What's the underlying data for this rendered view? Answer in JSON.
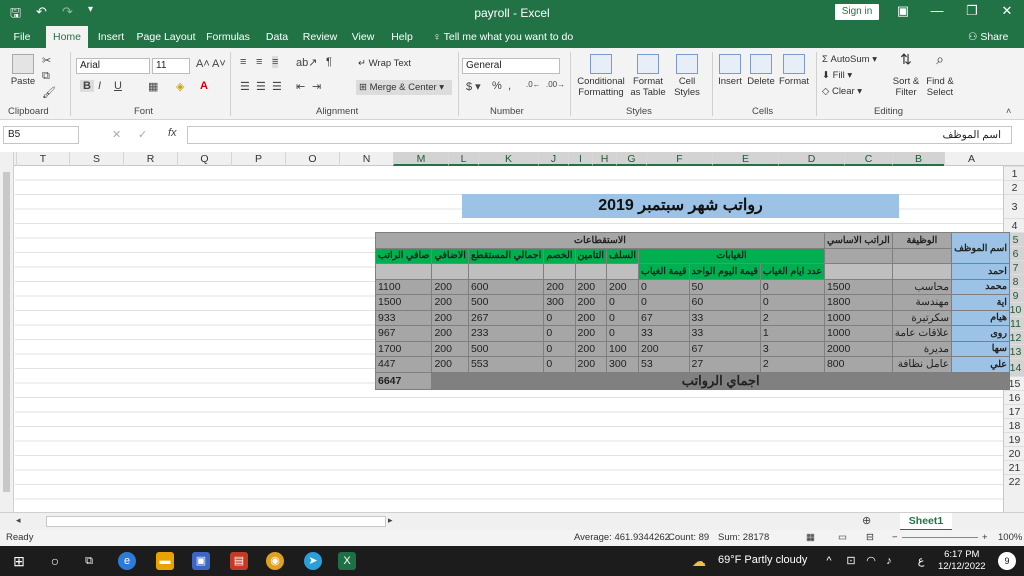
{
  "window": {
    "title": "payroll - Excel",
    "sign_in": "Sign in"
  },
  "tabs": [
    "File",
    "Home",
    "Insert",
    "Page Layout",
    "Formulas",
    "Data",
    "Review",
    "View",
    "Help"
  ],
  "tell_me": "Tell me what you want to do",
  "share": "Share",
  "ribbon": {
    "paste": "Paste",
    "font_name": "Arial",
    "font_size": "11",
    "wrap_text": "Wrap Text",
    "merge_center": "Merge & Center",
    "number_format": "General",
    "conditional_formatting": "Conditional Formatting",
    "format_as_table": "Format as Table",
    "cell_styles": "Cell Styles",
    "insert": "Insert",
    "delete": "Delete",
    "format": "Format",
    "autosum": "AutoSum",
    "fill": "Fill",
    "clear": "Clear",
    "sort_filter": "Sort & Filter",
    "find_select": "Find & Select",
    "groups": {
      "clipboard": "Clipboard",
      "font": "Font",
      "alignment": "Alignment",
      "number": "Number",
      "styles": "Styles",
      "cells": "Cells",
      "editing": "Editing"
    }
  },
  "formula_bar": {
    "name_box": "B5",
    "fx": "fx",
    "content": "اسم الموظف"
  },
  "columns": [
    "T",
    "S",
    "R",
    "Q",
    "P",
    "O",
    "N",
    "M",
    "L",
    "K",
    "J",
    "I",
    "H",
    "G",
    "F",
    "E",
    "D",
    "C",
    "B",
    "A"
  ],
  "rows": [
    "1",
    "2",
    "3",
    "4",
    "5",
    "6",
    "7",
    "8",
    "9",
    "10",
    "11",
    "12",
    "13",
    "14",
    "15",
    "16",
    "17",
    "18",
    "19",
    "20",
    "21",
    "22"
  ],
  "sheet_title": "رواتب شهر سبتمبر 2019",
  "table": {
    "h_employee": "اسم الموظف",
    "h_job": "الوظيفة",
    "h_base": "الراتب الاساسي",
    "h_deductions": "الاستقطاعات",
    "h_absences": "الغيابات",
    "h_absence_days": "عدد ايام الغياب",
    "h_day_value": "قيمة اليوم الواحد",
    "h_absence_value": "قيمة الغياب",
    "h_advances": "السلف",
    "h_insurance": "التامين",
    "h_discount": "الخصم",
    "h_total_ded": "اجمالي المستقطع",
    "h_overtime": "الاضافي",
    "h_net": "صافي الراتب",
    "rows": [
      {
        "name": "احمد",
        "job": "",
        "base": "",
        "days": "",
        "day_val": "",
        "abs_val": "",
        "adv": "",
        "ins": "",
        "disc": "",
        "total": "",
        "over": "",
        "net": ""
      },
      {
        "name": "محمد",
        "job": "محاسب",
        "base": "1500",
        "days": "0",
        "day_val": "50",
        "abs_val": "0",
        "adv": "200",
        "ins": "200",
        "disc": "200",
        "total": "600",
        "over": "200",
        "net": "1100"
      },
      {
        "name": "اية",
        "job": "مهندسة",
        "base": "1800",
        "days": "0",
        "day_val": "60",
        "abs_val": "0",
        "adv": "0",
        "ins": "200",
        "disc": "300",
        "total": "500",
        "over": "200",
        "net": "1500"
      },
      {
        "name": "هيام",
        "job": "سكرتيرة",
        "base": "1000",
        "days": "2",
        "day_val": "33",
        "abs_val": "67",
        "adv": "0",
        "ins": "200",
        "disc": "0",
        "total": "267",
        "over": "200",
        "net": "933"
      },
      {
        "name": "روى",
        "job": "علاقات عامة",
        "base": "1000",
        "days": "1",
        "day_val": "33",
        "abs_val": "33",
        "adv": "0",
        "ins": "200",
        "disc": "0",
        "total": "233",
        "over": "200",
        "net": "967"
      },
      {
        "name": "سها",
        "job": "مديرة",
        "base": "2000",
        "days": "3",
        "day_val": "67",
        "abs_val": "200",
        "adv": "100",
        "ins": "200",
        "disc": "0",
        "total": "500",
        "over": "200",
        "net": "1700"
      },
      {
        "name": "علي",
        "job": "عامل نظافة",
        "base": "800",
        "days": "2",
        "day_val": "27",
        "abs_val": "53",
        "adv": "300",
        "ins": "200",
        "disc": "0",
        "total": "553",
        "over": "200",
        "net": "447"
      }
    ],
    "total_label": "اجماي الرواتب",
    "total_value": "6647"
  },
  "sheet_tab": "Sheet1",
  "status": {
    "ready": "Ready",
    "average": "Average: 461.9344262",
    "count": "Count: 89",
    "sum": "Sum: 28178",
    "zoom": "100%"
  },
  "taskbar": {
    "weather": "69°F  Partly cloudy",
    "time": "6:17 PM",
    "date": "12/12/2022",
    "lang": "ع",
    "notif": "9"
  },
  "colors": {
    "excel_green": "#217346",
    "header_blue": "#9cc2e5",
    "header_green": "#00b050",
    "gray": "#a6a6a6"
  }
}
